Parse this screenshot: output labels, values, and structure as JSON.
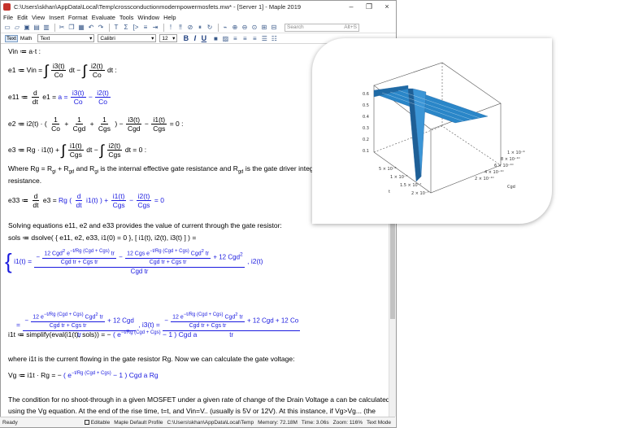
{
  "window": {
    "title": "C:\\Users\\skhan\\AppData\\Local\\Temp\\crossconductionmodernpowermosfets.mw* - [Server 1] - Maple 2019",
    "minimize": "–",
    "maximize": "❐",
    "close": "×"
  },
  "menu": [
    "File",
    "Edit",
    "View",
    "Insert",
    "Format",
    "Evaluate",
    "Tools",
    "Window",
    "Help"
  ],
  "toolbar": {
    "search_placeholder": "Search",
    "search_shortcut": "Alt+S"
  },
  "format": {
    "text_btn": "Text",
    "math_btn": "Math",
    "style": "Text",
    "font": "Calibri",
    "size": "12",
    "bold": "B",
    "italic": "I",
    "underline": "U"
  },
  "doc": {
    "vin": "Vin ≔ a·t :",
    "e1_prefix": "e1 ≔ Vin =",
    "e1_frac1_num": "i3(t)",
    "e1_frac1_den": "Co",
    "e1_mid": "dt −",
    "e1_frac2_num": "i2(t)",
    "e1_frac2_den": "Co",
    "e1_end": "dt :",
    "e11_prefix": "e11 ≔",
    "d_num": "d",
    "dt_den": "dt",
    "e11_mid": "e1 =",
    "e11_rhs": "a =",
    "e11_minus": "−",
    "e2_prefix": "e2 ≔ i2(t) ·",
    "e2_f1_num": "1",
    "e2_f1_den": "Co",
    "e2_f2_den": "Cgd",
    "e2_f3_den": "Cgs",
    "e2_end": "= 0 :",
    "e3_prefix": "e3 ≔ Rg · i1(t) +",
    "e3_f1_den": "Cgs",
    "e3_mid": "dt −",
    "e3_end": "dt = 0 :",
    "where_rg_a": "Where Rg = R",
    "where_rg_sub1": "gi",
    "where_rg_b": " + R",
    "where_rg_sub2": "gd",
    "where_rg_c": " and R",
    "where_rg_sub3": "gi",
    "where_rg_d": " is the internal effective gate resistance and R",
    "where_rg_sub4": "gd",
    "where_rg_e": " is the gate driver integra",
    "resistance": "resistance.",
    "e33_prefix": "e33 ≔",
    "e33_mid": "e3 =",
    "e33_rg": "Rg",
    "e33_i1": "i1(t)",
    "e33_plus": "+",
    "e33_f1_num": "i1(t)",
    "e33_f1_den": "Cgs",
    "e33_end": "= 0",
    "solving": "Solving equations e11, e2 and e33 provides the value of current through the gate resistor:",
    "sols": "sols ≔ dsolve( { e11, e2, e33, i1(0) = 0 }, [ i1(t), i2(t), i3(t) ] ) =",
    "sol_i1": "i1(t) =",
    "sol_a1": "12 Cgd",
    "sol_exp": "Rg (Cgd + Cgs)",
    "sol_t": "t",
    "sol_tr": "tr",
    "sol_den1": "Cgd tr + Cgs tr",
    "sol_b1": "12 Cgs e",
    "sol_b1b": "Cgd",
    "sol_plus12": "+ 12 Cgd",
    "sol_den_cgdtr": "Cgd tr",
    "sol_i2": ", i2(t)",
    "sol2_eq": "=",
    "sol2_a": "12 e",
    "sol2_a2": "Cgd",
    "sol2_plus": "+ 12 Cgd",
    "sol2_den_tr": "tr",
    "sol2_i3": ", i3(t) =",
    "sol2_c": "+ 12 Cgd + 12 Co",
    "i1t_prefix": "i1t ≔ simplify(eval(i1(t), sols)) = −",
    "i1t_e": "e",
    "i1t_minus1": "− 1",
    "i1t_cgd": "Cgd a",
    "where_i1t": "where i1t is the current flowing in the gate resistor Rg. Now we can calculate the gate voltage:",
    "vg_prefix": "Vg ≔ i1t · Rg = −",
    "vg_end": "Cgd a Rg",
    "cond1": "The condition for no shoot-through in a given MOSFET under a given rate of change of the Drain Voltage a can be calculated",
    "cond2": "using the Vg equation. At the end of the rise time, t=t, and Vin=V..  (usually is 5V or 12V). At this instance, if Vg>Vg... (the"
  },
  "status": {
    "ready": "Ready",
    "editable": "Editable",
    "profile": "Maple Default Profile",
    "path": "C:\\Users\\skhan\\AppData\\Local\\Temp",
    "memory": "Memory: 72.18M",
    "time": "Time: 3.06s",
    "zoom": "Zoom: 116%",
    "mode": "Text Mode"
  },
  "plot": {
    "z_ticks": [
      "0.6",
      "0.5",
      "0.4",
      "0.3",
      "0.2",
      "0.1"
    ],
    "t_ticks": [
      "5 × 10⁻⁸",
      "1 × 10⁻⁷",
      "1.5 × 10⁻⁷",
      "2 × 10⁻⁷"
    ],
    "t_label": "t",
    "cgd_ticks": [
      "2 × 10⁻¹⁰",
      "4 × 10⁻¹⁰",
      "6 × 10⁻¹⁰",
      "8 × 10⁻¹⁰",
      "1 × 10⁻⁹"
    ],
    "cgd_label": "Cgd",
    "surface_color": "#2a86c8"
  }
}
